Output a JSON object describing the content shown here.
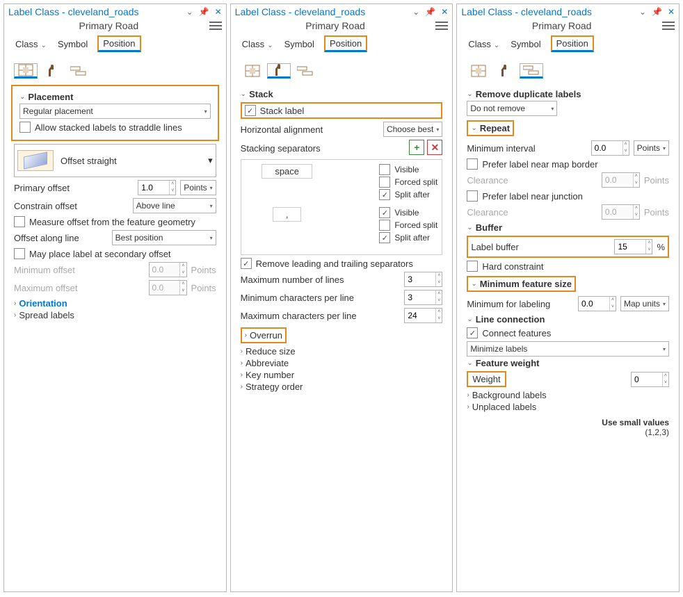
{
  "title": "Label Class - cleveland_roads",
  "subtitle": "Primary Road",
  "tabs": {
    "class": "Class",
    "symbol": "Symbol",
    "position": "Position"
  },
  "p1": {
    "placement": {
      "title": "Placement",
      "mode": "Regular placement",
      "straddle": "Allow stacked labels to straddle lines",
      "offsetStyle": "Offset straight"
    },
    "primaryOffset": {
      "label": "Primary offset",
      "value": "1.0",
      "unit": "Points"
    },
    "constrain": {
      "label": "Constrain offset",
      "value": "Above line"
    },
    "measure": "Measure offset from the feature geometry",
    "along": {
      "label": "Offset along line",
      "value": "Best position"
    },
    "secondary": "May place label at secondary offset",
    "minOff": {
      "label": "Minimum offset",
      "value": "0.0",
      "unit": "Points"
    },
    "maxOff": {
      "label": "Maximum offset",
      "value": "0.0",
      "unit": "Points"
    },
    "orientation": "Orientation",
    "spread": "Spread labels"
  },
  "p2": {
    "stack": {
      "title": "Stack",
      "checkbox": "Stack label",
      "halign": {
        "label": "Horizontal alignment",
        "value": "Choose best"
      },
      "sepTitle": "Stacking separators",
      "sep1": {
        "name": "space",
        "visible": "Visible",
        "forced": "Forced split",
        "after": "Split after"
      },
      "sep2": {
        "name": ",",
        "visible": "Visible",
        "forced": "Forced split",
        "after": "Split after"
      },
      "removeSep": "Remove leading and trailing separators",
      "maxLines": {
        "label": "Maximum number of lines",
        "value": "3"
      },
      "minChars": {
        "label": "Minimum characters per line",
        "value": "3"
      },
      "maxChars": {
        "label": "Maximum characters per line",
        "value": "24"
      }
    },
    "collapsed": {
      "overrun": "Overrun",
      "reduce": "Reduce size",
      "abbrev": "Abbreviate",
      "keynum": "Key number",
      "strat": "Strategy order"
    }
  },
  "p3": {
    "dup": {
      "title": "Remove duplicate labels",
      "value": "Do not remove"
    },
    "repeat": {
      "title": "Repeat",
      "min": {
        "label": "Minimum interval",
        "value": "0.0",
        "unit": "Points"
      },
      "border": "Prefer label near map border",
      "clear1": {
        "label": "Clearance",
        "value": "0.0",
        "unit": "Points"
      },
      "junction": "Prefer label near junction",
      "clear2": {
        "label": "Clearance",
        "value": "0.0",
        "unit": "Points"
      }
    },
    "buffer": {
      "title": "Buffer",
      "lb": {
        "label": "Label buffer",
        "value": "15",
        "unit": "%"
      },
      "hard": "Hard constraint"
    },
    "minfeat": {
      "title": "Minimum feature size",
      "ml": {
        "label": "Minimum for labeling",
        "value": "0.0",
        "unit": "Map units"
      }
    },
    "lineconn": {
      "title": "Line connection",
      "cf": "Connect features",
      "value": "Minimize labels"
    },
    "fweight": {
      "title": "Feature weight",
      "wl": "Weight",
      "value": "0"
    },
    "collapsed": {
      "bg": "Background labels",
      "unp": "Unplaced labels"
    },
    "annot1": "Use small values",
    "annot2": "(1,2,3)"
  }
}
